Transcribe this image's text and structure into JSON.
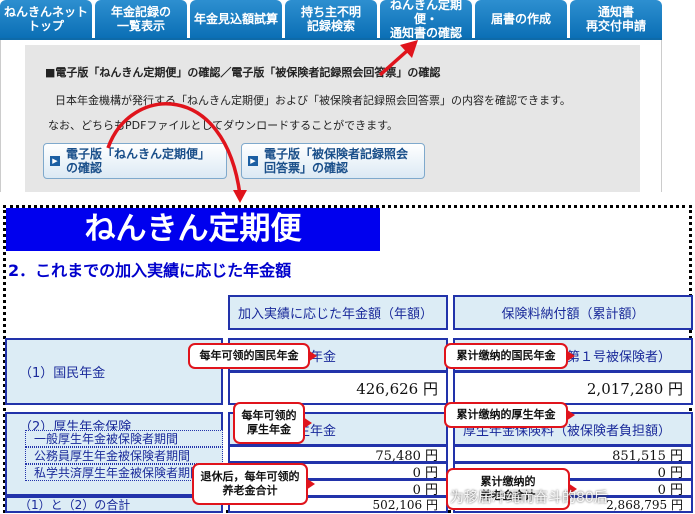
{
  "tabs": [
    "ねんきんネット\nトップ",
    "年金記録の\n一覧表示",
    "年金見込額試算",
    "持ち主不明\n記録検索",
    "ねんきん定期便・\n通知書の確認",
    "届書の作成",
    "通知書\n再交付申請"
  ],
  "panel": {
    "heading": "■電子版「ねんきん定期便」の確認／電子版「被保険者記録照会回答票」の確認",
    "line1": "日本年金機構が発行する「ねんきん定期便」および「被保険者記録照会回答票」の内容を確認できます。",
    "line2": "なお、どちらもPDFファイルとしてダウンロードすることができます。",
    "button1": "電子版「ねんきん定期便」の確認",
    "button2": "電子版「被保険者記録照会\n回答票」の確認"
  },
  "doc": {
    "banner": "ねんきん定期便",
    "section": "2．これまでの加入実績に応じた年金額",
    "col1_header": "加入実績に応じた年金額（年額）",
    "col2_header": "保険料納付額（累計額）",
    "row1": {
      "label": "（1）国民年金",
      "sub1": "老齢基礎年金",
      "val1": "426,626 円",
      "sub2": "国民年金保険料（第１号被保険者）",
      "val2": "2,017,280 円"
    },
    "row2": {
      "label": "（2）厚生年金保険",
      "sub1": "老齢厚生年金",
      "sub2": "厚生年金保険料（被保険者負担額）",
      "items": [
        {
          "label": "一般厚生年金被保険者期間",
          "val1": "75,480 円",
          "val2": "851,515 円"
        },
        {
          "label": "公務員厚生年金被保険者期間",
          "val1": "0 円",
          "val2": "0 円"
        },
        {
          "label": "私学共済厚生年金被保険者期間",
          "val1": "0 円",
          "val2": "0 円"
        }
      ]
    },
    "total": {
      "label": "（1）と（2）の合計",
      "val1": "502,106 円",
      "val2": "2,868,795 円"
    }
  },
  "callouts": {
    "c1": "每年可领的国民年金",
    "c2": "累计缴纳的国民年金",
    "c3": "每年可领的\n厚生年金",
    "c4": "累计缴纳的厚生年金",
    "c5": "退休后，每年可领的\n养老金合计",
    "c6": "累计缴纳的\n养老金合计"
  },
  "watermark": "为移居冲绳而奋斗的80后"
}
